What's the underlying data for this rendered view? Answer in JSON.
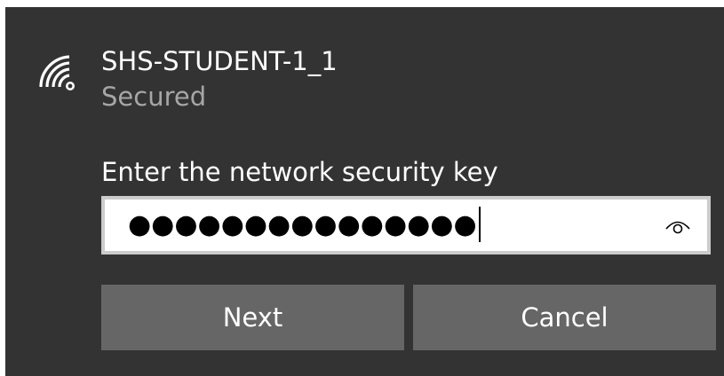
{
  "network": {
    "name": "SHS-STUDENT-1_1",
    "status": "Secured",
    "icon": "wifi-secured-icon"
  },
  "security_key": {
    "label": "Enter the network security key",
    "masked_value": "●●●●●●●●●●●●●●●",
    "reveal_icon": "eye-icon"
  },
  "buttons": {
    "next_label": "Next",
    "cancel_label": "Cancel"
  },
  "colors": {
    "panel_background": "#333333",
    "secondary_text": "#a6a6a6",
    "button_background": "#666666",
    "input_border": "#cccccc"
  }
}
